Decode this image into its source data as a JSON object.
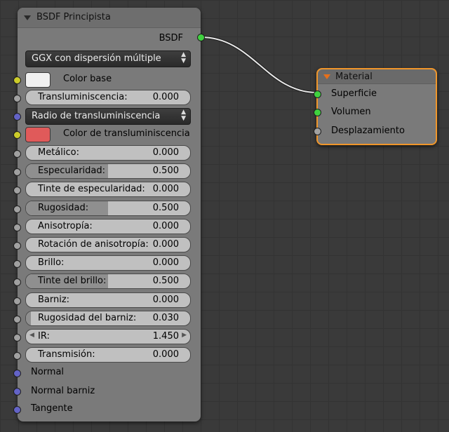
{
  "principled": {
    "title": "BSDF Principista",
    "output_label": "BSDF",
    "distribution": "GGX con dispersión múltiple",
    "base_color": {
      "label": "Color base",
      "color": "#f0f0f0"
    },
    "transluminiscencia": {
      "label": "Transluminiscencia:",
      "value": "0.000",
      "fraction": 0
    },
    "radius_dropdown": "Radio de transluminiscencia",
    "transluminiscencia_color": {
      "label": "Color de transluminiscencia",
      "color": "#e05a5a"
    },
    "inputs": [
      {
        "label": "Metálico:",
        "value": "0.000",
        "fraction": 0
      },
      {
        "label": "Especularidad:",
        "value": "0.500",
        "fraction": 0.5
      },
      {
        "label": "Tinte de especularidad:",
        "value": "0.000",
        "fraction": 0
      },
      {
        "label": "Rugosidad:",
        "value": "0.500",
        "fraction": 0.5
      },
      {
        "label": "Anisotropía:",
        "value": "0.000",
        "fraction": 0
      },
      {
        "label": "Rotación de anisotropía:",
        "value": "0.000",
        "fraction": 0
      },
      {
        "label": "Brillo:",
        "value": "0.000",
        "fraction": 0
      },
      {
        "label": "Tinte del brillo:",
        "value": "0.500",
        "fraction": 0.5
      },
      {
        "label": "Barniz:",
        "value": "0.000",
        "fraction": 0
      },
      {
        "label": "Rugosidad del barniz:",
        "value": "0.030",
        "fraction": 0.03
      },
      {
        "label": "IR:",
        "value": "1.450"
      },
      {
        "label": "Transmisión:",
        "value": "0.000",
        "fraction": 0
      }
    ],
    "vector_inputs": [
      "Normal",
      "Normal barniz",
      "Tangente"
    ]
  },
  "material": {
    "title": "Material",
    "inputs": [
      "Superficie",
      "Volumen",
      "Desplazamiento"
    ]
  },
  "colors": {
    "socket_yellow": "#cccc2a",
    "socket_gray": "#a1a1a1",
    "socket_blue": "#6363c7",
    "socket_green": "#3fd13f",
    "selected_outline": "#f0962a"
  }
}
